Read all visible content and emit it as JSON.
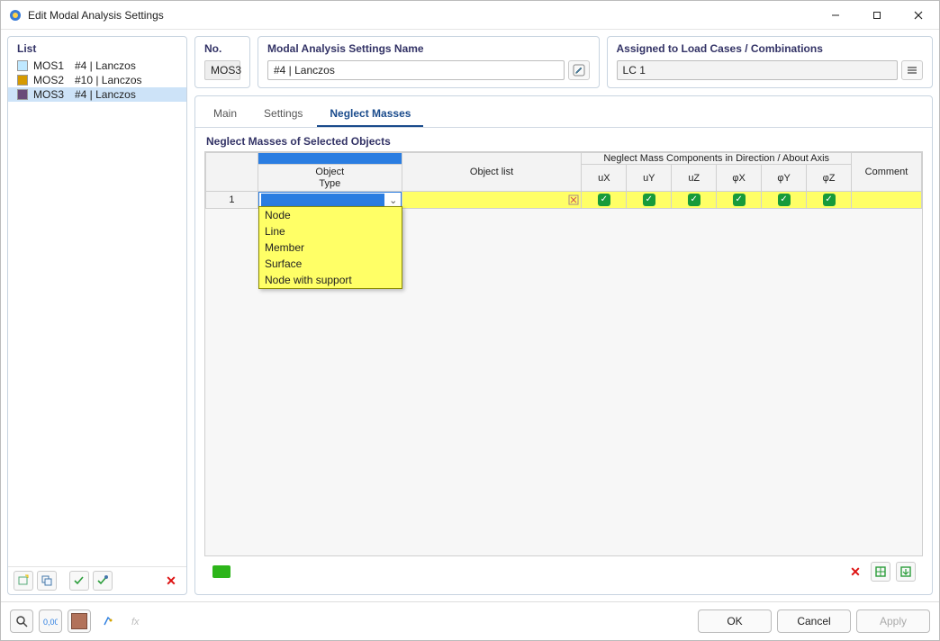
{
  "window": {
    "title": "Edit Modal Analysis Settings"
  },
  "list": {
    "header": "List",
    "items": [
      {
        "id": "MOS1",
        "name": "#4 | Lanczos",
        "color": "#bfe8ff",
        "selected": false
      },
      {
        "id": "MOS2",
        "name": "#10 | Lanczos",
        "color": "#d69a00",
        "selected": false
      },
      {
        "id": "MOS3",
        "name": "#4 | Lanczos",
        "color": "#6a4a78",
        "selected": true
      }
    ]
  },
  "no": {
    "header": "No.",
    "value": "MOS3"
  },
  "name": {
    "header": "Modal Analysis Settings Name",
    "value": "#4 | Lanczos"
  },
  "assigned": {
    "header": "Assigned to Load Cases / Combinations",
    "value": "LC 1"
  },
  "tabs": {
    "main": "Main",
    "settings": "Settings",
    "neglect": "Neglect Masses",
    "active": "neglect"
  },
  "section": {
    "header": "Neglect Masses of Selected Objects"
  },
  "gridHeaders": {
    "objectTypeL1": "Object",
    "objectTypeL2": "Type",
    "objectList": "Object list",
    "neglectSpan": "Neglect Mass Components in Direction / About Axis",
    "ux": "uX",
    "uy": "uY",
    "uz": "uZ",
    "phix": "φX",
    "phiy": "φY",
    "phiz": "φZ",
    "comment": "Comment"
  },
  "gridRow1": {
    "num": "1",
    "ux": true,
    "uy": true,
    "uz": true,
    "phix": true,
    "phiy": true,
    "phiz": true
  },
  "dropdown": {
    "options": [
      "Node",
      "Line",
      "Member",
      "Surface",
      "Node with support"
    ]
  },
  "footer": {
    "ok": "OK",
    "cancel": "Cancel",
    "apply": "Apply"
  },
  "colors": {
    "accent": "#2a7de1",
    "highlight": "#ffff66",
    "green": "#179b3a"
  }
}
